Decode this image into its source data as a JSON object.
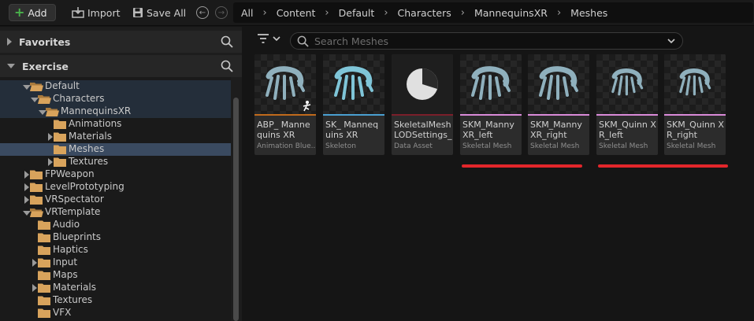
{
  "toolbar": {
    "add_label": "Add",
    "import_label": "Import",
    "save_all_label": "Save All"
  },
  "breadcrumb": [
    "All",
    "Content",
    "Default",
    "Characters",
    "MannequinsXR",
    "Meshes"
  ],
  "left_panel": {
    "favorites_label": "Favorites",
    "exercise_label": "Exercise",
    "tree": [
      {
        "label": "Default",
        "depth": 0,
        "expanded": true,
        "selected": false
      },
      {
        "label": "Characters",
        "depth": 1,
        "expanded": true,
        "selected": false
      },
      {
        "label": "MannequinsXR",
        "depth": 2,
        "expanded": true,
        "selected": false
      },
      {
        "label": "Animations",
        "depth": 3,
        "expanded": null,
        "selected": false
      },
      {
        "label": "Materials",
        "depth": 3,
        "expanded": false,
        "selected": false
      },
      {
        "label": "Meshes",
        "depth": 3,
        "expanded": null,
        "selected": true
      },
      {
        "label": "Textures",
        "depth": 3,
        "expanded": false,
        "selected": false
      },
      {
        "label": "FPWeapon",
        "depth": 0,
        "expanded": false,
        "selected": false
      },
      {
        "label": "LevelPrototyping",
        "depth": 0,
        "expanded": false,
        "selected": false
      },
      {
        "label": "VRSpectator",
        "depth": 0,
        "expanded": false,
        "selected": false
      },
      {
        "label": "VRTemplate",
        "depth": 0,
        "expanded": true,
        "selected": false
      },
      {
        "label": "Audio",
        "depth": 1,
        "expanded": null,
        "selected": false
      },
      {
        "label": "Blueprints",
        "depth": 1,
        "expanded": null,
        "selected": false
      },
      {
        "label": "Haptics",
        "depth": 1,
        "expanded": null,
        "selected": false
      },
      {
        "label": "Input",
        "depth": 1,
        "expanded": false,
        "selected": false
      },
      {
        "label": "Maps",
        "depth": 1,
        "expanded": null,
        "selected": false
      },
      {
        "label": "Materials",
        "depth": 1,
        "expanded": false,
        "selected": false
      },
      {
        "label": "Textures",
        "depth": 1,
        "expanded": null,
        "selected": false
      },
      {
        "label": "VFX",
        "depth": 1,
        "expanded": null,
        "selected": false
      }
    ]
  },
  "content": {
    "search_placeholder": "Search Meshes",
    "assets": [
      {
        "name": "ABP_ Mannequins XR",
        "type": "Animation Blue...",
        "bar_color": "#c06a1c",
        "thumb": "hand-anim"
      },
      {
        "name": "SK_ Mannequins XR",
        "type": "Skeleton",
        "bar_color": "#4a9fd0",
        "thumb": "hand-skeleton"
      },
      {
        "name": "SkeletalMesh LODSettings_ Hand",
        "type": "Data Asset",
        "bar_color": "#7a1f2a",
        "thumb": "pie"
      },
      {
        "name": "SKM_Manny XR_left",
        "type": "Skeletal Mesh",
        "bar_color": "#d98ad8",
        "thumb": "hand"
      },
      {
        "name": "SKM_Manny XR_right",
        "type": "Skeletal Mesh",
        "bar_color": "#d98ad8",
        "thumb": "hand"
      },
      {
        "name": "SKM_Quinn XR_left",
        "type": "Skeletal Mesh",
        "bar_color": "#d98ad8",
        "thumb": "hand-small"
      },
      {
        "name": "SKM_Quinn XR_right",
        "type": "Skeletal Mesh",
        "bar_color": "#d98ad8",
        "thumb": "hand-small"
      }
    ]
  },
  "colors": {
    "selection": "#3a4a60",
    "annotation_red": "#e2262b",
    "add_plus": "#49b24b"
  }
}
